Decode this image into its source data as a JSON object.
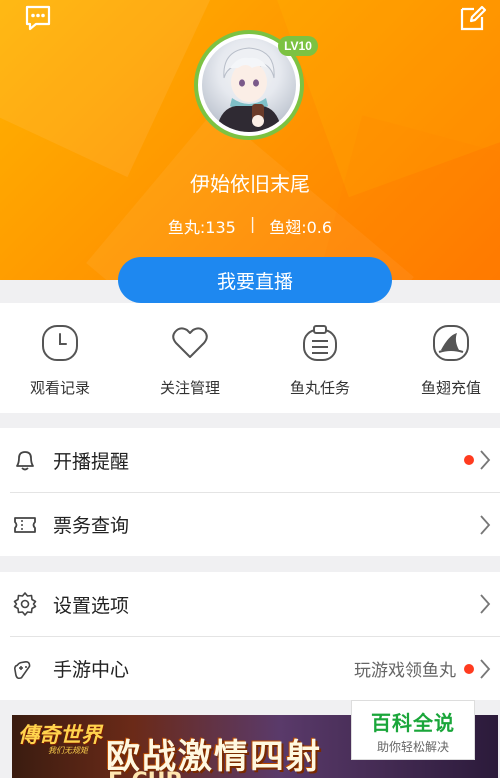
{
  "profile": {
    "username": "伊始依旧末尾",
    "level": "LV10",
    "fish_balls": "鱼丸:135",
    "separator": "|",
    "fish_fins": "鱼翅:0.6"
  },
  "actions": {
    "live_button": "我要直播"
  },
  "quick_actions": [
    {
      "label": "观看记录",
      "icon": "clock-icon"
    },
    {
      "label": "关注管理",
      "icon": "heart-icon"
    },
    {
      "label": "鱼丸任务",
      "icon": "clipboard-icon"
    },
    {
      "label": "鱼翅充值",
      "icon": "fin-icon"
    }
  ],
  "menu_group_1": [
    {
      "label": "开播提醒",
      "icon": "bell-icon",
      "badge_dot": true
    },
    {
      "label": "票务查询",
      "icon": "ticket-icon",
      "badge_dot": false
    }
  ],
  "menu_group_2": [
    {
      "label": "设置选项",
      "icon": "gear-icon",
      "badge_dot": false
    },
    {
      "label": "手游中心",
      "icon": "gamepad-icon",
      "badge_dot": true,
      "hint": "玩游戏领鱼丸"
    }
  ],
  "banner": {
    "logo": "傳奇世界",
    "logo_sub": "我们无规矩",
    "headline": "欧战激情四射",
    "subline": "F-CUP"
  },
  "watermark": {
    "title": "百科全说",
    "subtitle": "助你轻松解决"
  },
  "colors": {
    "header_orange": "#ff9800",
    "live_blue": "#1e88f0",
    "level_green": "#7cc242",
    "alert_red": "#ff3b1f"
  }
}
